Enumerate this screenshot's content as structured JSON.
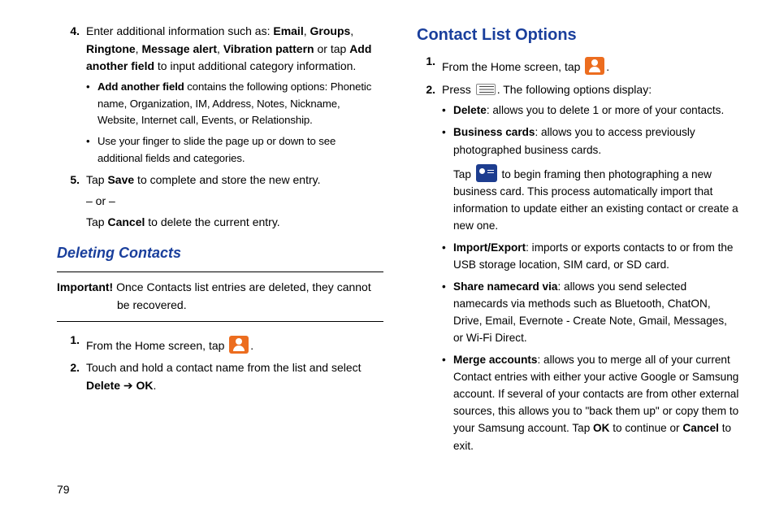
{
  "page_number": "79",
  "left": {
    "item4": {
      "num": "4.",
      "pre1": "Enter additional information such as: ",
      "b1": "Email",
      "sep1": ", ",
      "b2": "Groups",
      "sep2": ", ",
      "b3": "Ringtone",
      "sep3": ", ",
      "b4": "Message alert",
      "sep4": ", ",
      "b5": "Vibration pattern",
      "sep5": " or tap ",
      "b6": "Add another field",
      "post1": " to input additional category information.",
      "sub1_b": "Add another field",
      "sub1_text": " contains the following options: Phonetic name, Organization, IM, Address, Notes, Nickname, Website, Internet call, Events, or Relationship.",
      "sub2_text": "Use your finger to slide the page up or down to see additional fields and categories."
    },
    "item5": {
      "num": "5.",
      "pre": "Tap ",
      "b1": "Save",
      "post": " to complete and store the new entry.",
      "or": "– or –",
      "pre2": "Tap ",
      "b2": "Cancel",
      "post2": " to delete the current entry."
    },
    "heading": "Deleting Contacts",
    "important_label": "Important!",
    "important_text1": " Once Contacts list entries are deleted, they cannot",
    "important_text2": "be recovered.",
    "del1": {
      "num": "1.",
      "pre": "From the Home screen, tap ",
      "post": "."
    },
    "del2": {
      "num": "2.",
      "pre": "Touch and hold a contact name from the list and select ",
      "b1": "Delete",
      "arrow": " ➔ ",
      "b2": "OK",
      "post": "."
    }
  },
  "right": {
    "heading": "Contact List Options",
    "opt1": {
      "num": "1.",
      "pre": "From the Home screen, tap ",
      "post": "."
    },
    "opt2": {
      "num": "2.",
      "pre": "Press ",
      "post": ". The following options display:",
      "delete_b": "Delete",
      "delete_t": ": allows you to delete 1 or more of your contacts.",
      "bc_b": "Business cards",
      "bc_t": ": allows you to access previously photographed business cards.",
      "bc_tap_pre": "Tap ",
      "bc_tap_post": " to begin framing then photographing a new business card. This process automatically import that information to update either an existing contact or create a new one.",
      "ie_b": "Import/Export",
      "ie_t": ": imports or exports contacts to or from the USB storage location, SIM card, or SD card.",
      "sn_b": "Share namecard via",
      "sn_t": ": allows you send selected namecards via methods such as Bluetooth, ChatON, Drive, Email, Evernote - Create Note, Gmail, Messages, or Wi-Fi Direct.",
      "ma_b": "Merge accounts",
      "ma_t1": ": allows you to merge all of your current Contact entries with either your active Google or Samsung account. If several of your contacts are from other external sources, this allows you to \"back them up\" or copy them to your Samsung account. Tap ",
      "ma_ok": "OK",
      "ma_t2": " to continue or ",
      "ma_cancel": "Cancel",
      "ma_t3": " to exit."
    }
  }
}
